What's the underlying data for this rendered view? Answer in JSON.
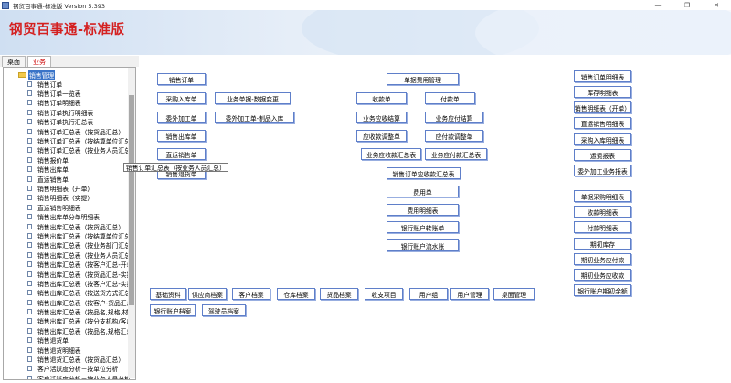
{
  "window": {
    "title": "钢贸百事通-标准版 Version 5.393",
    "controls": [
      "—",
      "❐",
      "✕"
    ]
  },
  "banner": {
    "brand": "钢贸百事通-标准版"
  },
  "tabs": [
    {
      "label": "桌面",
      "active": false
    },
    {
      "label": "业务",
      "active": true
    }
  ],
  "tree": {
    "root": "销售管理",
    "items": [
      "销售订单",
      "销售订单一览表",
      "销售订单明细表",
      "销售订单执行明细表",
      "销售订单执行汇总表",
      "销售订单汇总表（按货品汇总）",
      "销售订单汇总表（按结算单位汇总）",
      "销售订单汇总表（按业务人员汇总）",
      "销售报价单",
      "销售出库单",
      "直运销售单",
      "销售明细表（开单）",
      "销售明细表（实提）",
      "直运销售明细表",
      "销售出库单分单明细表",
      "销售出库汇总表（按货品汇总）",
      "销售出库汇总表（按结算单位汇总）",
      "销售出库汇总表（按业务部门汇总）",
      "销售出库汇总表（按业务人员汇总）",
      "销售出库汇总表（按客户汇总-开单",
      "销售出库汇总表（按货品汇总-实提",
      "销售出库汇总表（按客户汇总-实提",
      "销售出库汇总表（按送货方式汇总）",
      "销售出库汇总表（按客户-货品汇总",
      "销售出库汇总表（按品名,规格,材",
      "销售出库汇总表（按分支机构/客户",
      "销售出库汇总表（按品名,规格汇总",
      "销售退货单",
      "销售退货明细表",
      "销售退货汇总表（按货品汇总）",
      "客户活跃度分析－按单位分析",
      "客户活跃度分析－按业务人员分析"
    ]
  },
  "tooltip": "销售订单汇总表（按业务人员汇总）",
  "buttons": {
    "sales_order": "销售订单",
    "purchase_in": "采购入库单",
    "biz_bill_change": "业务单据-数据变更",
    "outsource": "委外加工单",
    "outsource_in": "委外加工单-制品入库",
    "sales_out": "销售出库单",
    "direct_sales": "直运销售单",
    "sales_return": "销售退货单",
    "bill_fee_mgmt": "单据费用管理",
    "receipt": "收款单",
    "payment": "付款单",
    "ar_settle": "业务应收结算",
    "ap_settle": "业务应付结算",
    "ar_adjust": "应收款调整单",
    "ap_adjust": "应付款调整单",
    "ar_summary": "业务应收款汇总表",
    "ap_summary": "业务应付款汇总表",
    "sales_order_ar_summary": "销售订单应收款汇总表",
    "expense": "费用单",
    "expense_detail": "费用明细表",
    "bank_transfer": "银行账户转账单",
    "bank_journal": "银行账户流水账",
    "sales_order_detail": "销售订单明细表",
    "inventory_detail": "库存明细表",
    "sales_detail_open": "销售明细表（开单）",
    "direct_sales_detail": "直运销售明细表",
    "purchase_in_detail": "采购入库明细表",
    "freight_report": "运费报表",
    "outsource_report": "委外加工业务报表",
    "purchase_detail": "单据采购明细表",
    "receipt_detail": "收款明细表",
    "payment_detail": "付款明细表",
    "opening_stock": "期初库存",
    "opening_ap": "期初业务应付款",
    "opening_ar": "期初业务应收款",
    "bank_opening": "银行账户期初余额",
    "basic_data": "基础资料",
    "supplier_file": "供应商档案",
    "customer_file": "客户档案",
    "warehouse_file": "仓库档案",
    "goods_file": "货品档案",
    "income_expense_item": "收支项目",
    "user_group": "用户组",
    "user_mgmt": "用户管理",
    "desktop_mgmt": "桌面管理",
    "bank_account_file": "银行账户档案",
    "driver_file": "驾驶员档案"
  }
}
